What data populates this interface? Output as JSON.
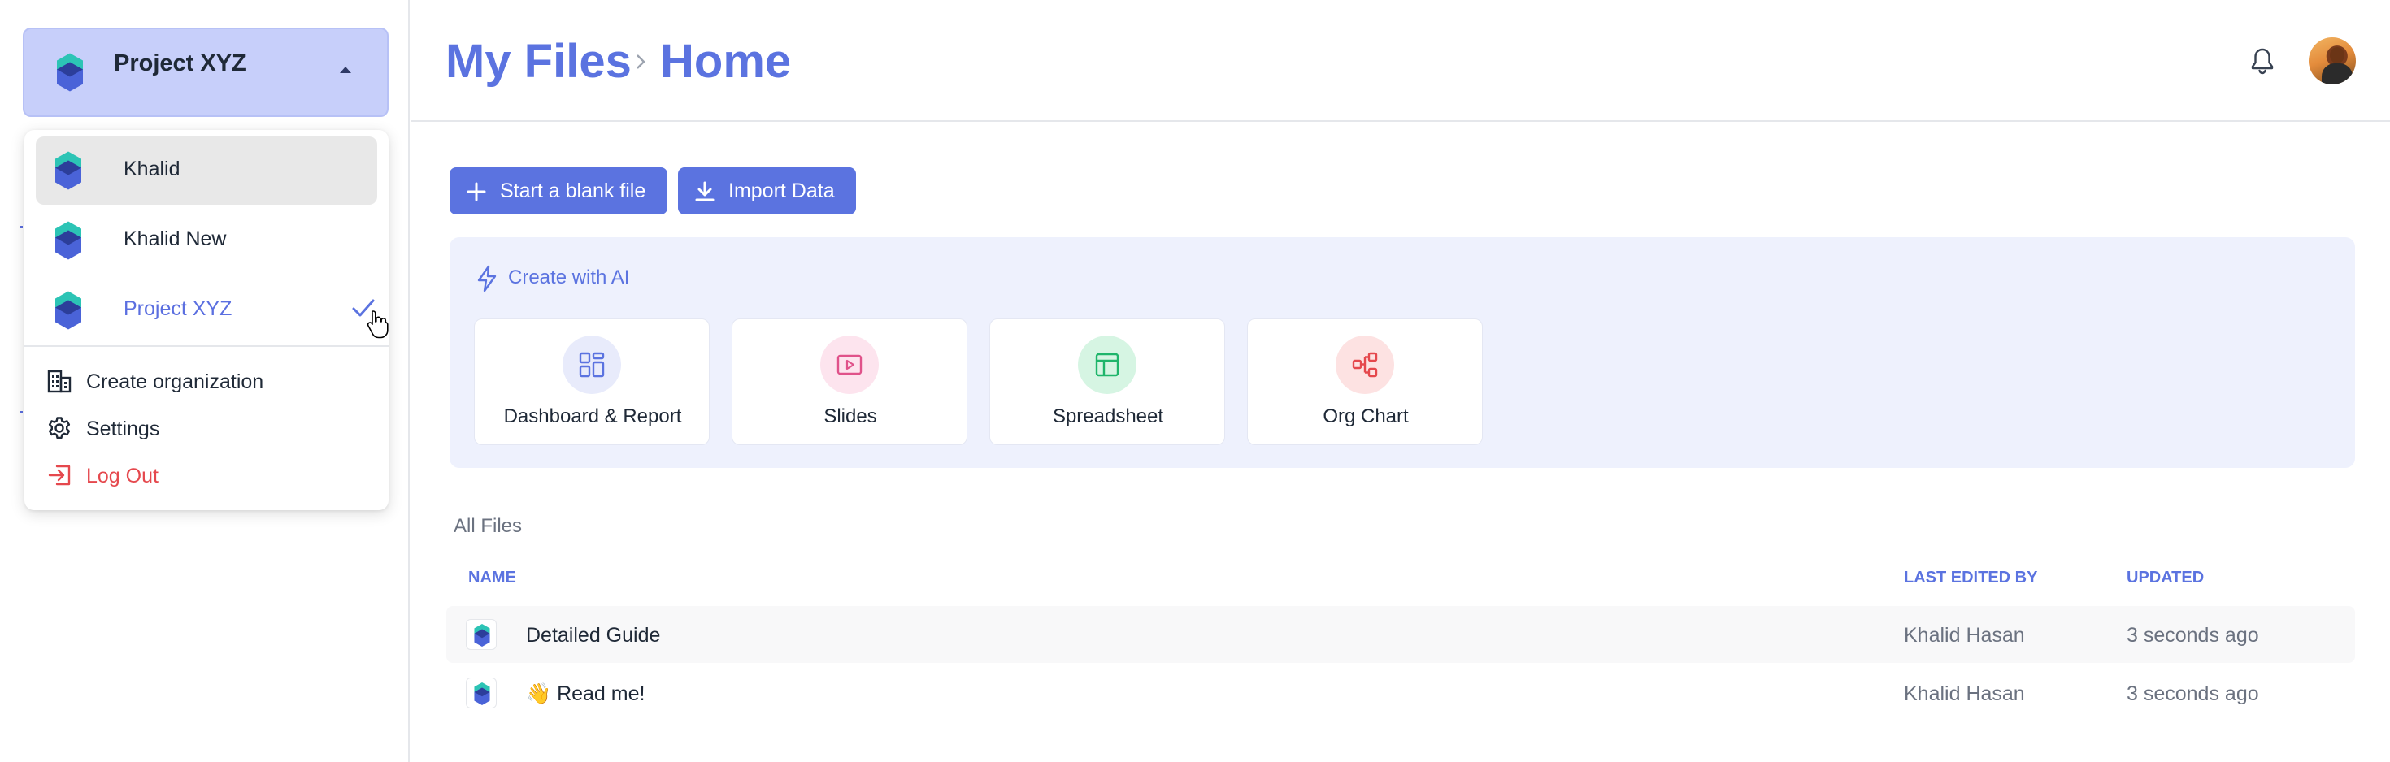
{
  "sidebar": {
    "current_org": "Project XYZ",
    "orgs": [
      {
        "label": "Khalid"
      },
      {
        "label": "Khalid New"
      },
      {
        "label": "Project XYZ"
      }
    ],
    "actions": [
      {
        "label": "Create organization",
        "icon": "building-icon"
      },
      {
        "label": "Settings",
        "icon": "gear-icon"
      },
      {
        "label": "Log Out",
        "icon": "logout-icon"
      }
    ]
  },
  "header": {
    "breadcrumb": [
      "My Files",
      "Home"
    ]
  },
  "toolbar": {
    "blank_label": "Start a blank file",
    "import_label": "Import Data"
  },
  "ai": {
    "title": "Create with AI",
    "cards": [
      {
        "label": "Dashboard & Report",
        "icon": "dashboard-icon",
        "bg": "#e8ebfb",
        "color": "#5b73e0"
      },
      {
        "label": "Slides",
        "icon": "slides-icon",
        "bg": "#fde4ee",
        "color": "#e0528a"
      },
      {
        "label": "Spreadsheet",
        "icon": "spreadsheet-icon",
        "bg": "#d6f5e3",
        "color": "#1fb56b"
      },
      {
        "label": "Org Chart",
        "icon": "org-chart-icon",
        "bg": "#fde2e2",
        "color": "#e5484d"
      }
    ]
  },
  "files": {
    "section_title": "All Files",
    "columns": {
      "name": "NAME",
      "editor": "LAST EDITED BY",
      "updated": "UPDATED"
    },
    "rows": [
      {
        "name": "Detailed Guide",
        "editor": "Khalid Hasan",
        "updated": "3 seconds ago"
      },
      {
        "name": "👋 Read me!",
        "editor": "Khalid Hasan",
        "updated": "3 seconds ago"
      }
    ]
  },
  "colors": {
    "accent": "#5b73e0",
    "danger": "#e5484d",
    "switcher_bg": "#c7cffa",
    "ai_panel_bg": "#eef1fd"
  }
}
